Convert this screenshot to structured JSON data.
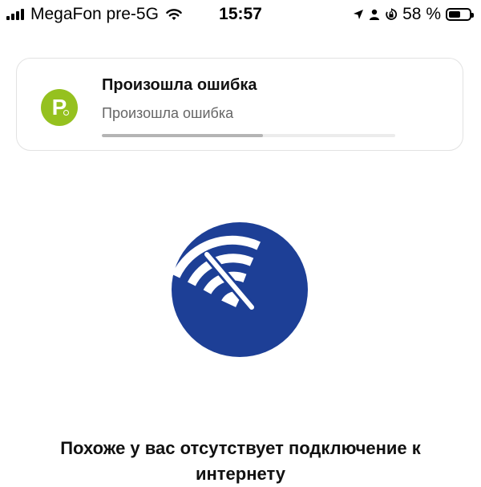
{
  "status_bar": {
    "carrier": "MegaFon pre-5G",
    "time": "15:57",
    "battery_percent": "58 %",
    "battery_level": 0.58,
    "icons": [
      "signal-icon",
      "wifi-icon",
      "location-icon",
      "person-icon",
      "orientation-lock-icon",
      "battery-icon"
    ]
  },
  "error_card": {
    "app_logo_letter": "P",
    "title": "Произошла ошибка",
    "subtitle": "Произошла ошибка",
    "progress": 0.55,
    "colors": {
      "logo": "#95c11f",
      "progress_fill": "#b4b4b4"
    }
  },
  "main": {
    "icon": "no-wifi-icon",
    "icon_color": "#1d3f96",
    "message": "Похоже у вас отсутствует подключение к интернету"
  }
}
